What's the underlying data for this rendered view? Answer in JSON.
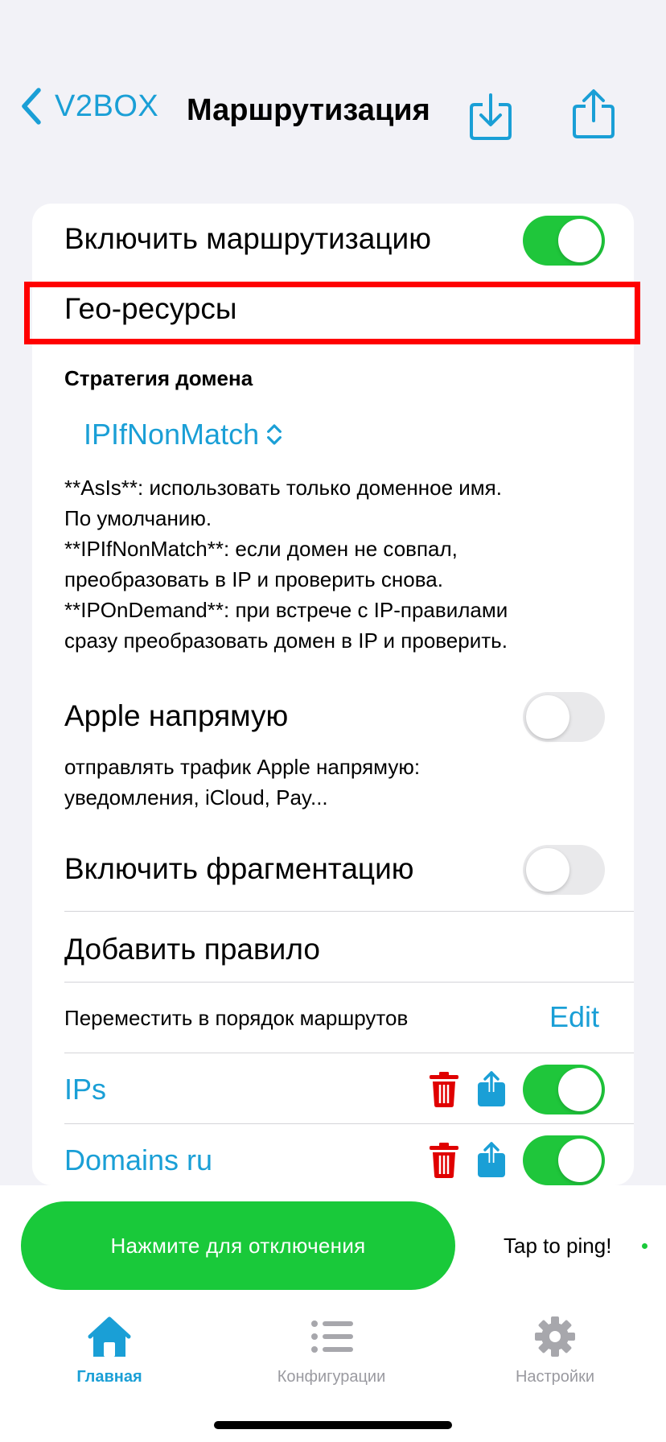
{
  "nav": {
    "back_label": "V2BOX",
    "title": "Маршрутизация"
  },
  "settings": {
    "enable_routing_label": "Включить маршрутизацию",
    "enable_routing_on": true,
    "geo_resources_label": "Гео-ресурсы",
    "domain_strategy_label": "Стратегия домена",
    "domain_strategy_value": "IPIfNonMatch",
    "domain_strategy_desc": [
      "**AsIs**: использовать только доменное имя.",
      "По умолчанию.",
      "**IPIfNonMatch**: если домен не совпал,",
      "преобразовать в IP и проверить снова.",
      "**IPOnDemand**: при встрече с IP-правилами",
      "сразу преобразовать домен в IP и проверить."
    ],
    "apple_direct_label": "Apple напрямую",
    "apple_direct_on": false,
    "apple_direct_desc": [
      "отправлять трафик Apple напрямую:",
      "уведомления, iCloud, Pay..."
    ],
    "fragmentation_label": "Включить фрагментацию",
    "fragmentation_on": false,
    "add_rule_label": "Добавить правило",
    "reorder_label": "Переместить в порядок маршрутов",
    "edit_label": "Edit"
  },
  "rules": [
    {
      "name": "IPs",
      "enabled": true
    },
    {
      "name": "Domains ru",
      "enabled": true
    }
  ],
  "bottom": {
    "connect_button_label": "Нажмите для отключения",
    "ping_label": "Tap to ping!"
  },
  "tabs": [
    {
      "label": "Главная",
      "icon": "house-icon",
      "active": true
    },
    {
      "label": "Конфигурации",
      "icon": "list-icon",
      "active": false
    },
    {
      "label": "Настройки",
      "icon": "gear-icon",
      "active": false
    }
  ],
  "colors": {
    "accent": "#1a9fd6",
    "toggle_on": "#1fc63b",
    "connect_button": "#19c93a",
    "delete": "#e00000",
    "highlight": "#ff0000"
  }
}
